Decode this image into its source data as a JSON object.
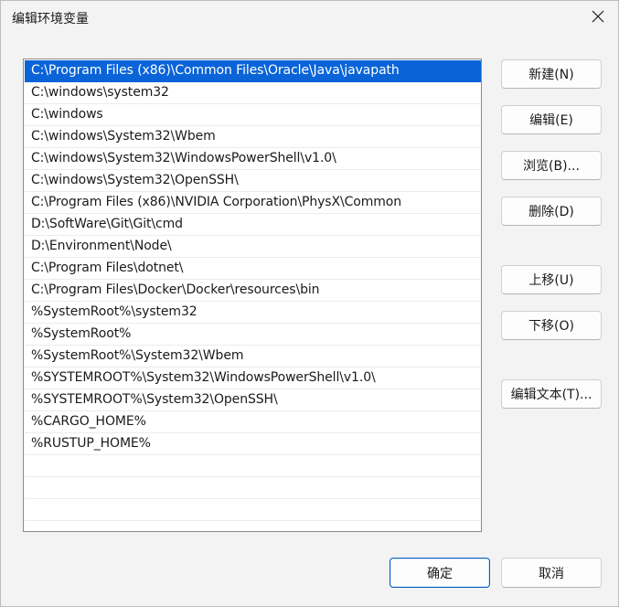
{
  "window": {
    "title": "编辑环境变量"
  },
  "paths": [
    "C:\\Program Files (x86)\\Common Files\\Oracle\\Java\\javapath",
    "C:\\windows\\system32",
    "C:\\windows",
    "C:\\windows\\System32\\Wbem",
    "C:\\windows\\System32\\WindowsPowerShell\\v1.0\\",
    "C:\\windows\\System32\\OpenSSH\\",
    "C:\\Program Files (x86)\\NVIDIA Corporation\\PhysX\\Common",
    "D:\\SoftWare\\Git\\Git\\cmd",
    "D:\\Environment\\Node\\",
    "C:\\Program Files\\dotnet\\",
    "C:\\Program Files\\Docker\\Docker\\resources\\bin",
    "%SystemRoot%\\system32",
    "%SystemRoot%",
    "%SystemRoot%\\System32\\Wbem",
    "%SYSTEMROOT%\\System32\\WindowsPowerShell\\v1.0\\",
    "%SYSTEMROOT%\\System32\\OpenSSH\\",
    "%CARGO_HOME%",
    "%RUSTUP_HOME%"
  ],
  "selected_index": 0,
  "buttons": {
    "new": "新建(N)",
    "edit": "编辑(E)",
    "browse": "浏览(B)...",
    "delete": "删除(D)",
    "move_up": "上移(U)",
    "move_down": "下移(O)",
    "edit_text": "编辑文本(T)...",
    "ok": "确定",
    "cancel": "取消"
  },
  "colors": {
    "selection": "#0a64d8",
    "background": "#f3f3f3"
  },
  "icons": {
    "close": "close-icon"
  }
}
